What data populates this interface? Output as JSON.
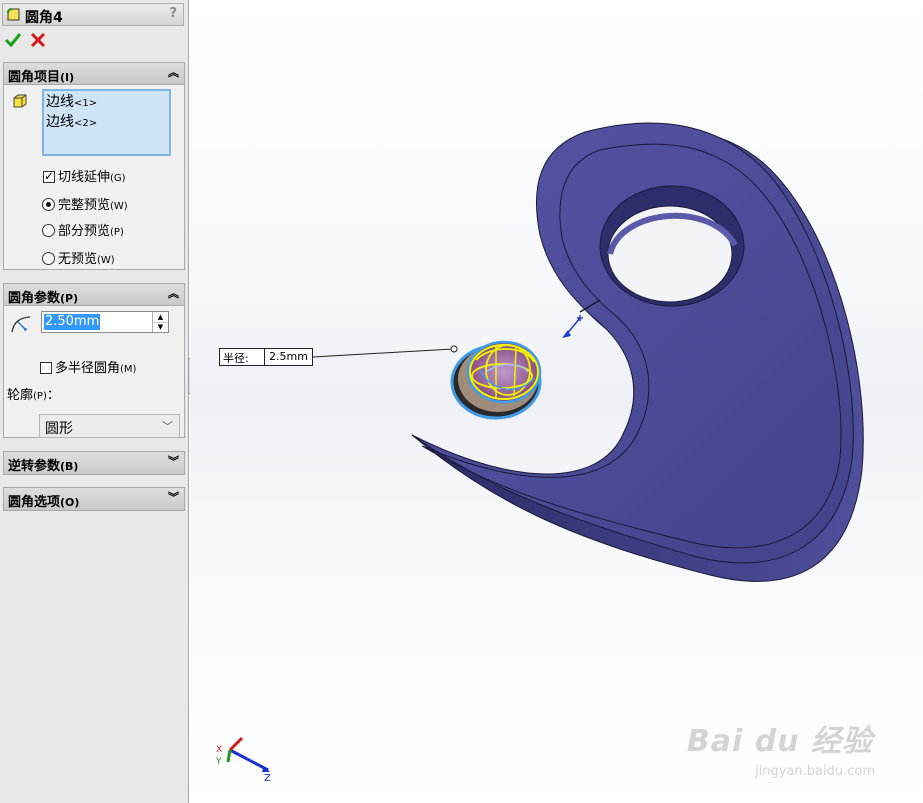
{
  "panel": {
    "title": "圆角4",
    "help": "?",
    "groups": {
      "items": {
        "label": "圆角项目",
        "key": "(I)",
        "edges": [
          {
            "name": "边线",
            "index": "<1>"
          },
          {
            "name": "边线",
            "index": "<2>"
          }
        ],
        "tangent": {
          "label": "切线延伸",
          "hint": "(G)",
          "checked": true
        },
        "preview_options": [
          {
            "label": "完整预览",
            "hint": "(W)",
            "selected": true
          },
          {
            "label": "部分预览",
            "hint": "(P)",
            "selected": false
          },
          {
            "label": "无预览",
            "hint": "(W)",
            "selected": false
          }
        ]
      },
      "params": {
        "label": "圆角参数",
        "key": "(P)",
        "radius_value": "2.50mm",
        "multi_radius": {
          "label": "多半径圆角",
          "hint": "(M)",
          "checked": false
        },
        "profile_label": "轮廓",
        "profile_hint": "(P)",
        "profile_colon": "：",
        "profile_value": "圆形"
      },
      "reverse": {
        "label": "逆转参数",
        "key": "(B)"
      },
      "options": {
        "label": "圆角选项",
        "key": "(O)"
      }
    }
  },
  "viewport": {
    "callout": {
      "label": "半径:",
      "value": "2.5mm"
    },
    "triad": {
      "x": "X",
      "y": "Y",
      "z": "Z"
    },
    "watermark": {
      "main": "Bai du 经验",
      "sub": "jingyan.baidu.com"
    }
  },
  "colors": {
    "model_face": "#4b4b94",
    "model_edge": "#1a1a3a",
    "highlight": "#f2f200",
    "selection": "#3f9be8",
    "panel_bg": "#e8e8e8"
  }
}
